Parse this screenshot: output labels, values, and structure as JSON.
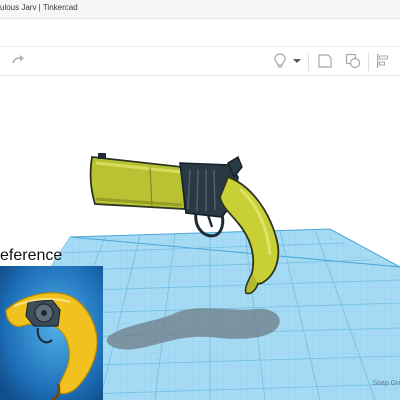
{
  "window": {
    "title": "ulous Jarv | Tinkercad"
  },
  "toolbar": {
    "redo_icon": "redo-arrow-icon",
    "items": [
      {
        "name": "light-bulb-icon"
      },
      {
        "name": "dropdown-arrow-icon"
      },
      {
        "name": "note-icon"
      },
      {
        "name": "copy-shape-icon"
      },
      {
        "name": "align-icon"
      }
    ]
  },
  "reference": {
    "label": "eference"
  },
  "workplane": {
    "snap_grid_label": "Snap Gri",
    "grid_color": "#9dd7f1",
    "grid_line_color": "#6fbde3"
  },
  "model": {
    "barrel_color": "#b8c232",
    "body_color": "#2a3a44",
    "grip_color": "#c8d036"
  }
}
